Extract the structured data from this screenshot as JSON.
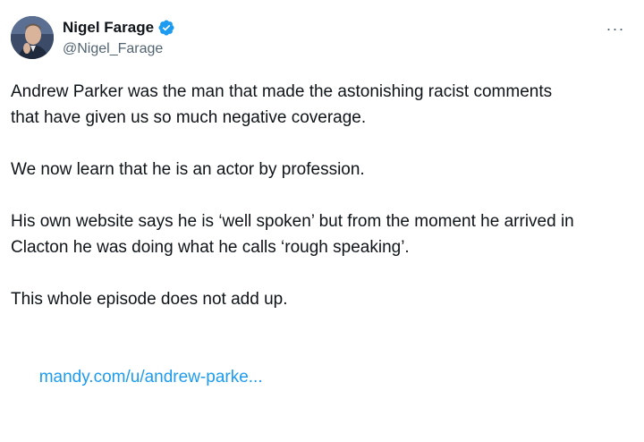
{
  "author": {
    "display_name": "Nigel Farage",
    "handle": "@Nigel_Farage",
    "verified": true
  },
  "more_menu": {
    "icon": "more-horizontal-icon",
    "label": "···"
  },
  "tweet": {
    "paragraphs": [
      "Andrew Parker was the man that made the astonishing racist comments\nthat have given us so much negative coverage.",
      "We now learn that he is an actor by profession.",
      "His own website says he is ‘well spoken’ but from the moment he arrived in\nClacton he was doing what he calls ‘rough speaking’.",
      "This whole episode does not add up."
    ],
    "link_text": "mandy.com/u/andrew-parke..."
  },
  "colors": {
    "accent": "#1d9bf0",
    "text": "#0f1419",
    "secondary": "#536471"
  }
}
